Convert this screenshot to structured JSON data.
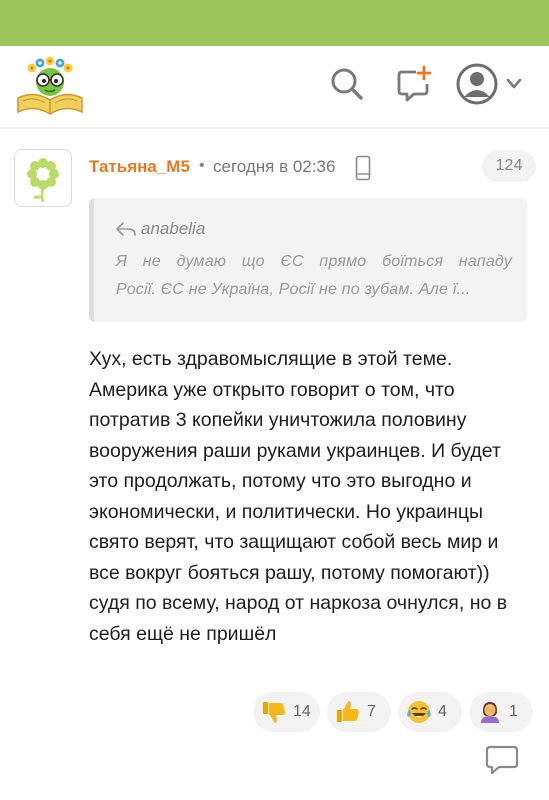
{
  "header": {
    "logo": "flower-book-logo",
    "icons": [
      "search-icon",
      "add-post-icon",
      "user-avatar-icon",
      "chevron-down-icon"
    ]
  },
  "comment": {
    "author": "Татьяна_M5",
    "separator": "•",
    "time": "сегодня в 02:36",
    "device_icon": "mobile-phone-icon",
    "count": "124",
    "quote": {
      "author": "anabelia",
      "line1": "Я не думаю що ЄС прямо боїться нападу",
      "line2": "Росії. ЄС не Україна, Росії не по зубам. Але ї..."
    },
    "body": "Хух, есть здравомыслящие в этой теме. Америка уже открыто говорит о том, что потратив 3 копейки уничтожила половину вооружения раши руками украинцев. И будет это продолжать, потому что это выгодно и экономически, и политически. Но украинцы свято верят, что защищают собой весь мир и все вокруг бояться рашу, потому помогают)) судя по всему, народ от наркоза очнулся, но в себя ещё не пришёл",
    "reactions": [
      {
        "emoji": "thumbs-down",
        "count": "14"
      },
      {
        "emoji": "thumbs-up",
        "count": "7"
      },
      {
        "emoji": "tears-of-joy",
        "count": "4"
      },
      {
        "emoji": "facepalm",
        "count": "1"
      }
    ]
  },
  "colors": {
    "top_bar": "#9dc65c",
    "author": "#e27a22",
    "reaction_bg": "#f3f3f3",
    "quote_bg": "#f3f3f3"
  }
}
